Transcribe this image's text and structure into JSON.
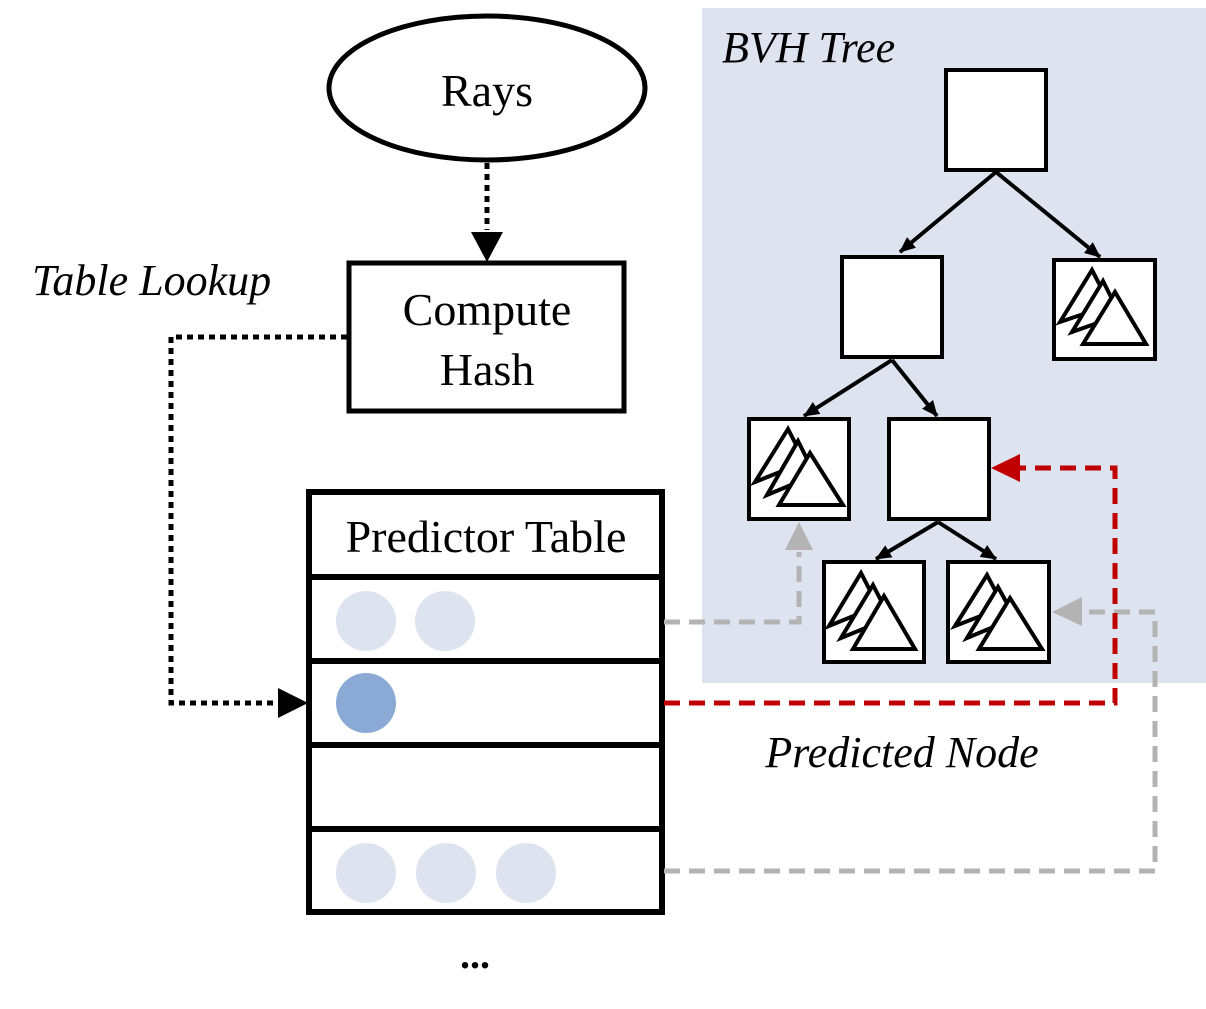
{
  "labels": {
    "rays": "Rays",
    "compute_hash_line1": "Compute",
    "compute_hash_line2": "Hash",
    "table_lookup": "Table Lookup",
    "predictor_table": "Predictor Table",
    "bvh_tree": "BVH Tree",
    "predicted_node": "Predicted Node",
    "ellipsis": "..."
  },
  "colors": {
    "bvh_background": "#dde3ef",
    "entry_light": "#dde3ef",
    "entry_active": "#8aaad5",
    "predicted_arrow": "#c00000",
    "inactive_arrow": "#b3b3b3",
    "stroke": "#000000"
  },
  "predictor_table": {
    "rows": [
      {
        "entries": 2,
        "active": false,
        "link": "inactive"
      },
      {
        "entries": 1,
        "active": true,
        "link": "predicted"
      },
      {
        "entries": 0,
        "active": false,
        "link": "none"
      },
      {
        "entries": 3,
        "active": false,
        "link": "inactive"
      }
    ]
  }
}
